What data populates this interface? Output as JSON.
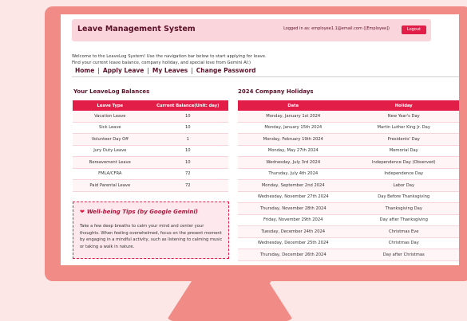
{
  "header": {
    "title": "Leave Management System",
    "logged_in": "Logged in as: employee1.1@email.com ([Employee])",
    "logout": "Logout"
  },
  "welcome": {
    "line1": "Welcome to the LeaveLog System! Use the navigation bar below to start applying for leave.",
    "line2": "Find your current leave balance, company holiday, and special love from Gemini AI:)"
  },
  "nav": [
    "Home",
    "Apply Leave",
    "My Leaves",
    "Change Password"
  ],
  "balances": {
    "title": "Your LeaveLog Balances",
    "columns": [
      "Leave Type",
      "Current Balance(Unit: day)"
    ],
    "rows": [
      [
        "Vacation Leave",
        "10"
      ],
      [
        "Sick Leave",
        "10"
      ],
      [
        "Volunteer Day Off",
        "1"
      ],
      [
        "Jury Duty Leave",
        "10"
      ],
      [
        "Bereavement Leave",
        "10"
      ],
      [
        "FMLA/CFRA",
        "72"
      ],
      [
        "Paid Parental Leave",
        "72"
      ]
    ]
  },
  "holidays": {
    "title": "2024 Company Holidays",
    "columns": [
      "Date",
      "Holiday"
    ],
    "rows": [
      [
        "Monday, January 1st 2024",
        "New Year's Day"
      ],
      [
        "Monday, January 15th 2024",
        "Martin Luther King Jr. Day"
      ],
      [
        "Monday, February 19th 2024",
        "Presidents' Day"
      ],
      [
        "Monday, May 27th 2024",
        "Memorial Day"
      ],
      [
        "Wednesday, July 3rd 2024",
        "Independence Day (Observed)"
      ],
      [
        "Thursday, July 4th 2024",
        "Independence Day"
      ],
      [
        "Monday, September 2nd 2024",
        "Labor Day"
      ],
      [
        "Wednesday, November 27th 2024",
        "Day Before Thanksgiving"
      ],
      [
        "Thursday, November 28th 2024",
        "Thanksgiving Day"
      ],
      [
        "Friday, November 29th 2024",
        "Day after Thanksgiving"
      ],
      [
        "Tuesday, December 24th 2024",
        "Christmas Eve"
      ],
      [
        "Wednesday, December 25th 2024",
        "Christmas Day"
      ],
      [
        "Thursday, December 26th 2024",
        "Day after Christmas"
      ]
    ]
  },
  "tips": {
    "icon": "heart-icon",
    "title": "Well-being Tips (by Google Gemini)",
    "body": "Take a few deep breaths to calm your mind and center your thoughts. When feeling overwhelmed, focus on the present moment by engaging in a mindful activity, such as listening to calming music or taking a walk in nature."
  }
}
